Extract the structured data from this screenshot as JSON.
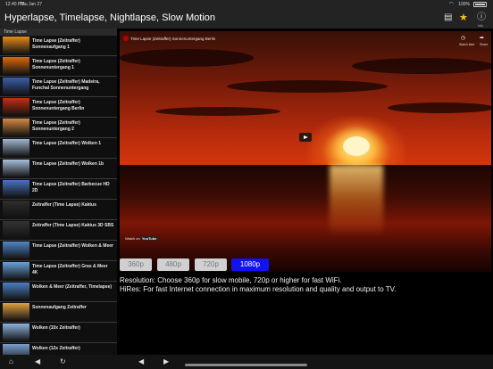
{
  "status_bar": {
    "time": "12:40 PM",
    "date": "Thu Jan 27",
    "battery_percent": "100%"
  },
  "header": {
    "title": "Hyperlapse, Timelapse, Nightlapse, Slow Motion",
    "info_label": "Info",
    "star_color": "#f5c518"
  },
  "sidebar": {
    "section_title": "Time Lapse",
    "items": [
      {
        "label": "Time Lapse (Zeitraffer) Sonnenaufgang 1",
        "thumb": "#e58a1a"
      },
      {
        "label": "Time Lapse (Zeitraffer) Sonnenuntergang 1",
        "thumb": "#d86a10"
      },
      {
        "label": "Time Lapse (Zeitraffer) Madeira, Funchal Sonnenuntergang",
        "thumb": "#3a5fa8"
      },
      {
        "label": "Time Lapse (Zeitraffer) Sonnenuntergang Berlin",
        "thumb": "#c23010"
      },
      {
        "label": "Time Lapse (Zeitraffer) Sonnenuntergang 2",
        "thumb": "#d58a40"
      },
      {
        "label": "Time Lapse (Zeitraffer) Wolken 1",
        "thumb": "#9fb6d0"
      },
      {
        "label": "Time Lapse (Zeitraffer) Wolken 1b",
        "thumb": "#a9c0dc"
      },
      {
        "label": "Time Lapse (Zeitraffer) Barbecue HD 2D",
        "thumb": "#4a72c0"
      },
      {
        "label": "Zeitraffer (Time Lapse) Kaktus",
        "thumb": "#2e2e2e"
      },
      {
        "label": "Zeitraffer (Time Lapse) Kaktus 3D SBS",
        "thumb": "#333333"
      },
      {
        "label": "Time Lapse (Zeitraffer) Wolken & Meer",
        "thumb": "#4f86c8"
      },
      {
        "label": "Time Lapse (Zeitraffer) Gras & Meer 4K",
        "thumb": "#6aa2d8"
      },
      {
        "label": "Wolken & Meer (Zeitraffer, Timelapse)",
        "thumb": "#4b7fc4"
      },
      {
        "label": "Sonnenaufgang Zeitraffer",
        "thumb": "#e0a040"
      },
      {
        "label": "Wolken (10x Zeitraffer)",
        "thumb": "#8fb2e0"
      },
      {
        "label": "Wolken (12x Zeitraffer)",
        "thumb": "#7aa0d0"
      }
    ]
  },
  "video": {
    "title": "Time Lapse (Zeitraffer) Sonnenuntergang Berlin",
    "watch_later": "Watch later",
    "share": "Share",
    "watch_on": "Watch on",
    "youtube": "YouTube"
  },
  "resolution": {
    "options": [
      "360p",
      "480p",
      "720p",
      "1080p"
    ],
    "selected": "1080p",
    "line1": "Resolution: Choose 360p for slow mobile, 720p or higher for fast WiFi.",
    "line2": "HiRes: For fast Internet connection in maximum resolution and quality and output to TV."
  }
}
